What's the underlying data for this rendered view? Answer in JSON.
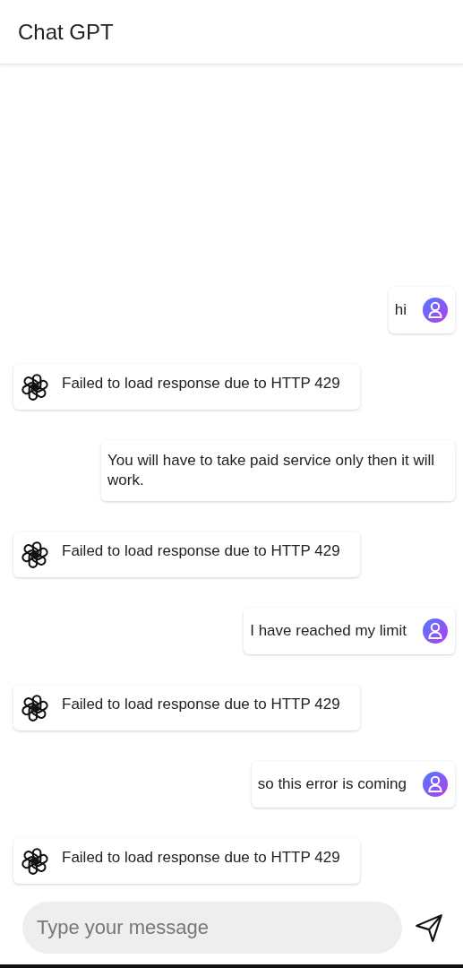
{
  "header": {
    "title": "Chat GPT"
  },
  "messages": [
    {
      "kind": "user",
      "text": "hi",
      "avatar": true
    },
    {
      "kind": "bot",
      "text": "Failed to load response due to HTTP 429"
    },
    {
      "kind": "user",
      "text": "You will have to take paid service only then it will work.",
      "avatar": false
    },
    {
      "kind": "bot",
      "text": "Failed to load response due to HTTP 429"
    },
    {
      "kind": "user",
      "text": "I have reached my limit",
      "avatar": true
    },
    {
      "kind": "bot",
      "text": "Failed to load response due to HTTP 429"
    },
    {
      "kind": "user",
      "text": "so this error is coming",
      "avatar": true
    },
    {
      "kind": "bot",
      "text": "Failed to load response due to HTTP 429"
    }
  ],
  "composer": {
    "placeholder": "Type your message"
  }
}
